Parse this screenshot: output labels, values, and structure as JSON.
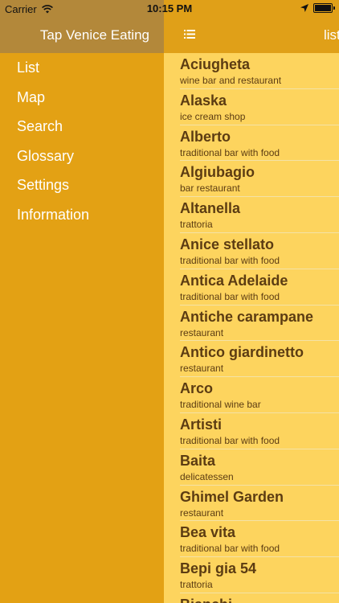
{
  "status_bar": {
    "carrier": "Carrier",
    "time": "10:15 PM",
    "icons": [
      "wifi-icon",
      "location-arrow-icon",
      "battery-icon"
    ]
  },
  "drawer": {
    "title": "Tap Venice Eating",
    "items": [
      {
        "label": "List"
      },
      {
        "label": "Map"
      },
      {
        "label": "Search"
      },
      {
        "label": "Glossary"
      },
      {
        "label": "Settings"
      },
      {
        "label": "Information"
      }
    ]
  },
  "main": {
    "nav_title": "list",
    "menu_icon": "list-icon",
    "rows": [
      {
        "name": "Aciugheta",
        "type": "wine bar and restaurant"
      },
      {
        "name": "Alaska",
        "type": "ice cream shop"
      },
      {
        "name": "Alberto",
        "type": "traditional bar with food"
      },
      {
        "name": "Algiubagio",
        "type": "bar restaurant"
      },
      {
        "name": "Altanella",
        "type": "trattoria"
      },
      {
        "name": "Anice stellato",
        "type": "traditional bar with food"
      },
      {
        "name": "Antica Adelaide",
        "type": "traditional bar with food"
      },
      {
        "name": "Antiche carampane",
        "type": "restaurant"
      },
      {
        "name": "Antico giardinetto",
        "type": "restaurant"
      },
      {
        "name": "Arco",
        "type": "traditional wine bar"
      },
      {
        "name": "Artisti",
        "type": "traditional bar with food"
      },
      {
        "name": "Baita",
        "type": "delicatessen"
      },
      {
        "name": "Ghimel Garden",
        "type": "restaurant"
      },
      {
        "name": "Bea vita",
        "type": "traditional bar with food"
      },
      {
        "name": "Bepi gia 54",
        "type": "trattoria"
      },
      {
        "name": "Bianchi",
        "type": ""
      }
    ]
  },
  "colors": {
    "drawer_bg": "#e3a114",
    "drawer_header_bg": "#b3883a",
    "navbar_bg": "#e0a018",
    "list_bg": "#fdd45e",
    "row_text": "#5c3c12"
  }
}
